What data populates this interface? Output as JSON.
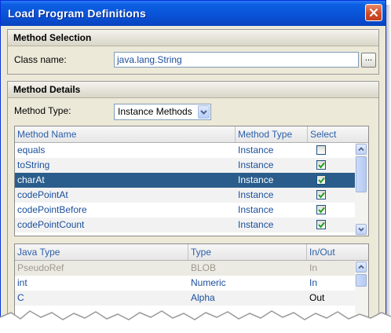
{
  "window": {
    "title": "Load Program Definitions"
  },
  "method_selection": {
    "header": "Method Selection",
    "class_label": "Class name:",
    "class_value": "java.lang.String",
    "browse_label": "..."
  },
  "method_details": {
    "header": "Method Details",
    "type_label": "Method Type:",
    "type_value": "Instance Methods"
  },
  "methods_table": {
    "columns": [
      "Method Name",
      "Method Type",
      "Select"
    ],
    "rows": [
      {
        "name": "equals",
        "type": "Instance",
        "selected": false
      },
      {
        "name": "toString",
        "type": "Instance",
        "selected": true
      },
      {
        "name": "charAt",
        "type": "Instance",
        "selected": true,
        "highlighted": true
      },
      {
        "name": "codePointAt",
        "type": "Instance",
        "selected": true
      },
      {
        "name": "codePointBefore",
        "type": "Instance",
        "selected": true
      },
      {
        "name": "codePointCount",
        "type": "Instance",
        "selected": true
      }
    ]
  },
  "params_table": {
    "columns": [
      "Java Type",
      "Type",
      "In/Out"
    ],
    "rows": [
      {
        "java_type": "PseudoRef",
        "type": "BLOB",
        "inout": "In",
        "disabled": true
      },
      {
        "java_type": "int",
        "type": "Numeric",
        "inout": "In"
      },
      {
        "java_type": "C",
        "type": "Alpha",
        "inout": "Out"
      }
    ]
  },
  "colors": {
    "titlebar": "#0a52d6",
    "selection": "#2a5d8c",
    "header_text": "#2b5fa8",
    "value_text": "#1a4f9c"
  }
}
